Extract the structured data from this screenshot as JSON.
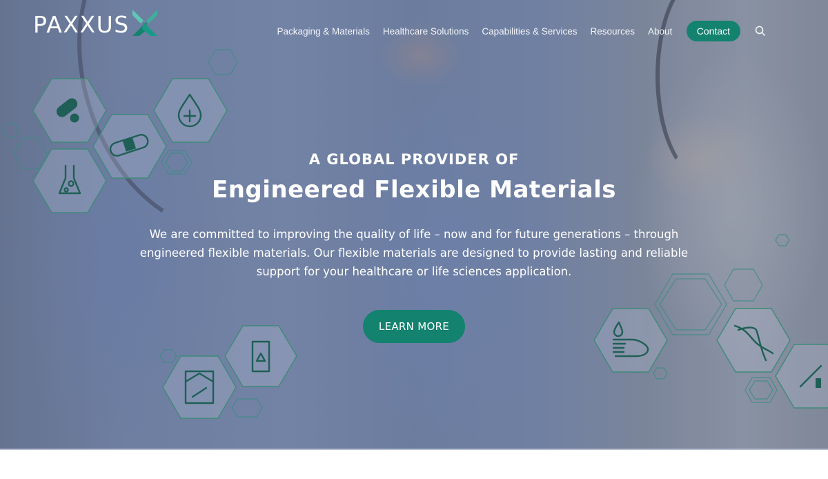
{
  "brand": {
    "name": "PAXXUS",
    "accent_color": "#13826f",
    "logo_icon": "paxxus-x-mark-icon"
  },
  "nav": {
    "items": [
      {
        "label": "Packaging & Materials"
      },
      {
        "label": "Healthcare Solutions"
      },
      {
        "label": "Capabilities & Services"
      },
      {
        "label": "Resources"
      },
      {
        "label": "About"
      }
    ],
    "contact_label": "Contact",
    "search_icon": "search-icon"
  },
  "hero": {
    "kicker": "A GLOBAL PROVIDER OF",
    "headline": "Engineered Flexible Materials",
    "lede_lines": [
      "We are committed to improving the quality of life – now and for future generations – through",
      "engineered flexible materials. Our flexible materials are designed to provide lasting and reliable",
      "support for your healthcare or life sciences application."
    ],
    "cta_label": "LEARN MORE",
    "decor_icons": [
      "pills-icon",
      "blood-drop-plus-icon",
      "bandage-icon",
      "lab-flask-icon",
      "bone-xray-icon",
      "hazard-package-icon",
      "hand-drop-icon",
      "dna-icon",
      "syringe-vial-icon"
    ]
  }
}
